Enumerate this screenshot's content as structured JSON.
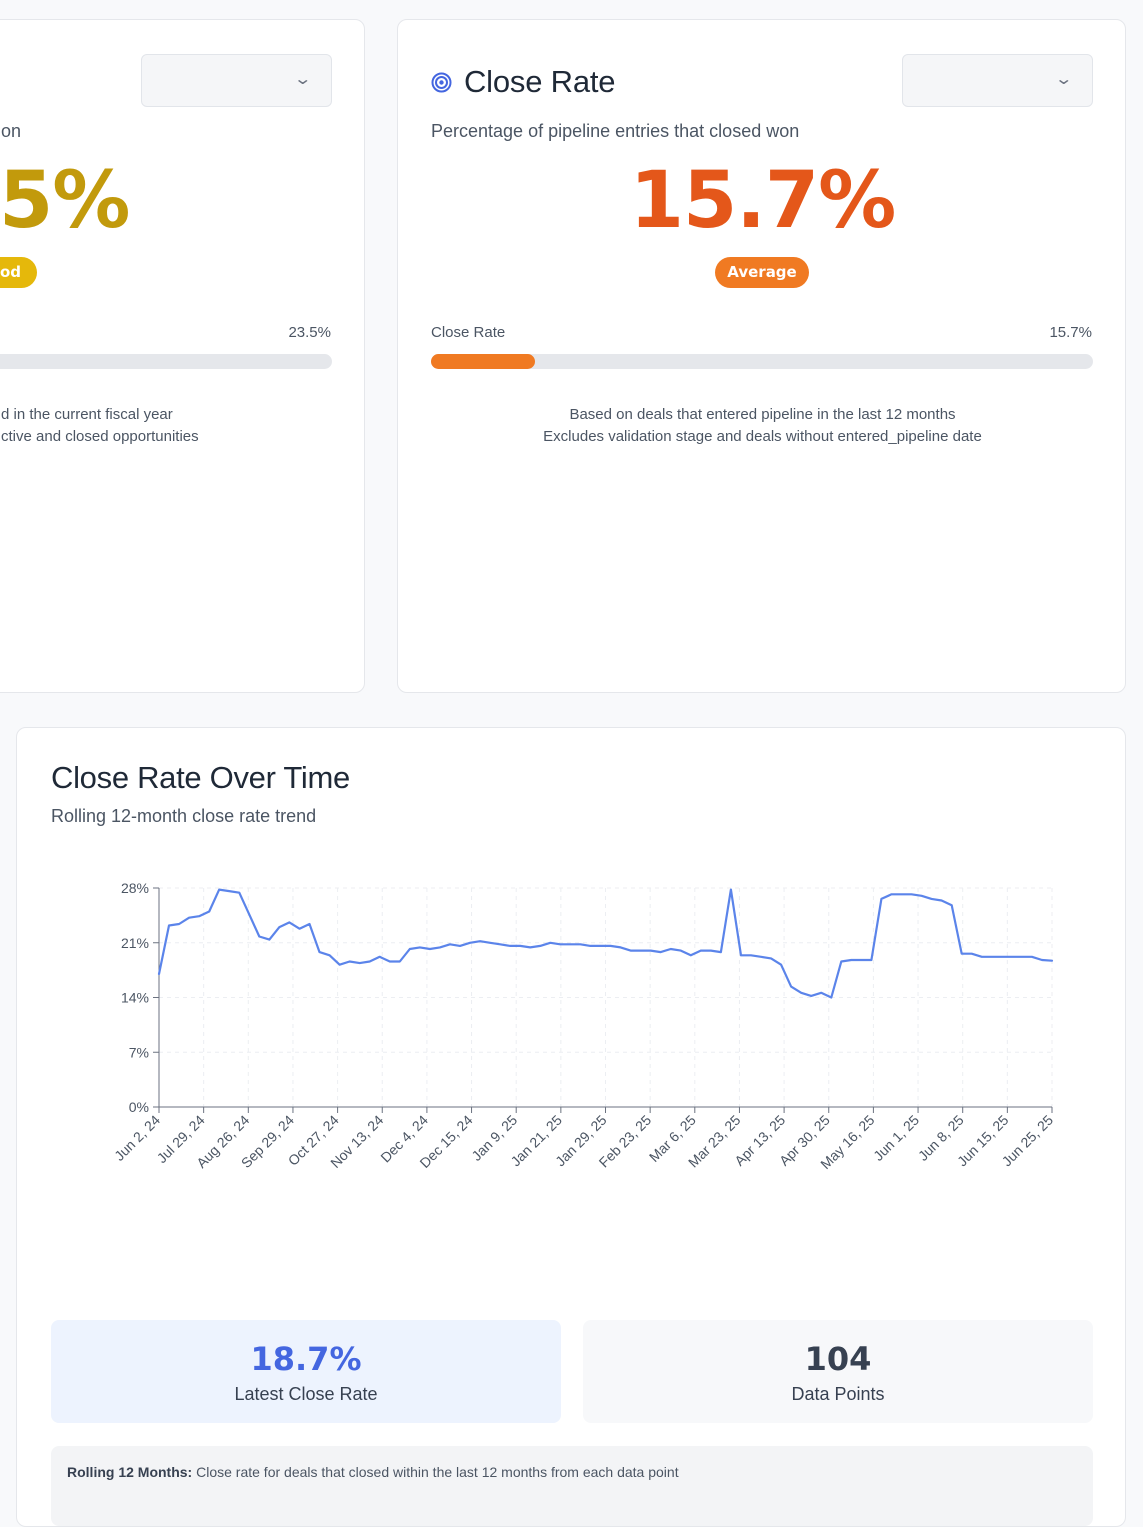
{
  "left_card": {
    "subtitle_fragment": "on",
    "value_fragment": "5%",
    "value_color": "#c29a0c",
    "badge_fragment": "od",
    "badge_color": "#e5b80b",
    "bar_value_label": "23.5%",
    "note_line1": "d in the current fiscal year",
    "note_line2": "ctive and closed opportunities"
  },
  "right_card": {
    "title": "Close Rate",
    "icon": "target-icon",
    "subtitle": "Percentage of pipeline entries that closed won",
    "value": "15.7%",
    "value_color": "#e4571a",
    "badge": "Average",
    "badge_color": "#f07a22",
    "bar_label": "Close Rate",
    "bar_value_label": "15.7%",
    "bar_fraction": 0.157,
    "note_line1": "Based on deals that entered pipeline in the last 12 months",
    "note_line2": "Excludes validation stage and deals without entered_pipeline date"
  },
  "chart_card": {
    "title": "Close Rate Over Time",
    "subtitle": "Rolling 12-month close rate trend",
    "stats": [
      {
        "value": "18.7%",
        "label": "Latest Close Rate",
        "color": "#4466e0",
        "bg": "#edf3fe"
      },
      {
        "value": "104",
        "label": "Data Points",
        "color": "#374151",
        "bg": "#f7f8fa"
      }
    ],
    "footnote_bold": "Rolling 12 Months:",
    "footnote_text": " Close rate for deals that closed within the last 12 months from each data point"
  },
  "chart_data": {
    "type": "line",
    "color": "#5b84ea",
    "y_ticks": [
      "0%",
      "7%",
      "14%",
      "21%",
      "28%"
    ],
    "ylim": [
      0,
      28
    ],
    "grid": true,
    "x_tick_labels": [
      "Jun 2, 24",
      "Jul 29, 24",
      "Aug 26, 24",
      "Sep 29, 24",
      "Oct 27, 24",
      "Nov 13, 24",
      "Dec 4, 24",
      "Dec 15, 24",
      "Jan 9, 25",
      "Jan 21, 25",
      "Jan 29, 25",
      "Feb 23, 25",
      "Mar 6, 25",
      "Mar 23, 25",
      "Apr 13, 25",
      "Apr 30, 25",
      "May 16, 25",
      "Jun 1, 25",
      "Jun 8, 25",
      "Jun 15, 25",
      "Jun 25, 25"
    ],
    "series": [
      {
        "values": [
          17.0,
          23.2,
          23.4,
          24.2,
          24.4,
          25.0,
          27.8,
          27.6,
          27.4,
          24.6,
          21.8,
          21.4,
          23.0,
          23.6,
          22.8,
          23.4,
          19.8,
          19.4,
          18.2,
          18.6,
          18.4,
          18.6,
          19.2,
          18.6,
          18.6,
          20.2,
          20.4,
          20.2,
          20.4,
          20.8,
          20.6,
          21.0,
          21.2,
          21.0,
          20.8,
          20.6,
          20.6,
          20.4,
          20.6,
          21.0,
          20.8,
          20.8,
          20.8,
          20.6,
          20.6,
          20.6,
          20.4,
          20.0,
          20.0,
          20.0,
          19.8,
          20.2,
          20.0,
          19.4,
          20.0,
          20.0,
          19.8,
          27.8,
          19.4,
          19.4,
          19.2,
          19.0,
          18.2,
          15.4,
          14.6,
          14.2,
          14.6,
          14.0,
          18.6,
          18.8,
          18.8,
          18.8,
          26.6,
          27.2,
          27.2,
          27.2,
          27.0,
          26.6,
          26.4,
          25.8,
          19.6,
          19.6,
          19.2,
          19.2,
          19.2,
          19.2,
          19.2,
          19.2,
          18.8,
          18.7
        ]
      }
    ]
  }
}
